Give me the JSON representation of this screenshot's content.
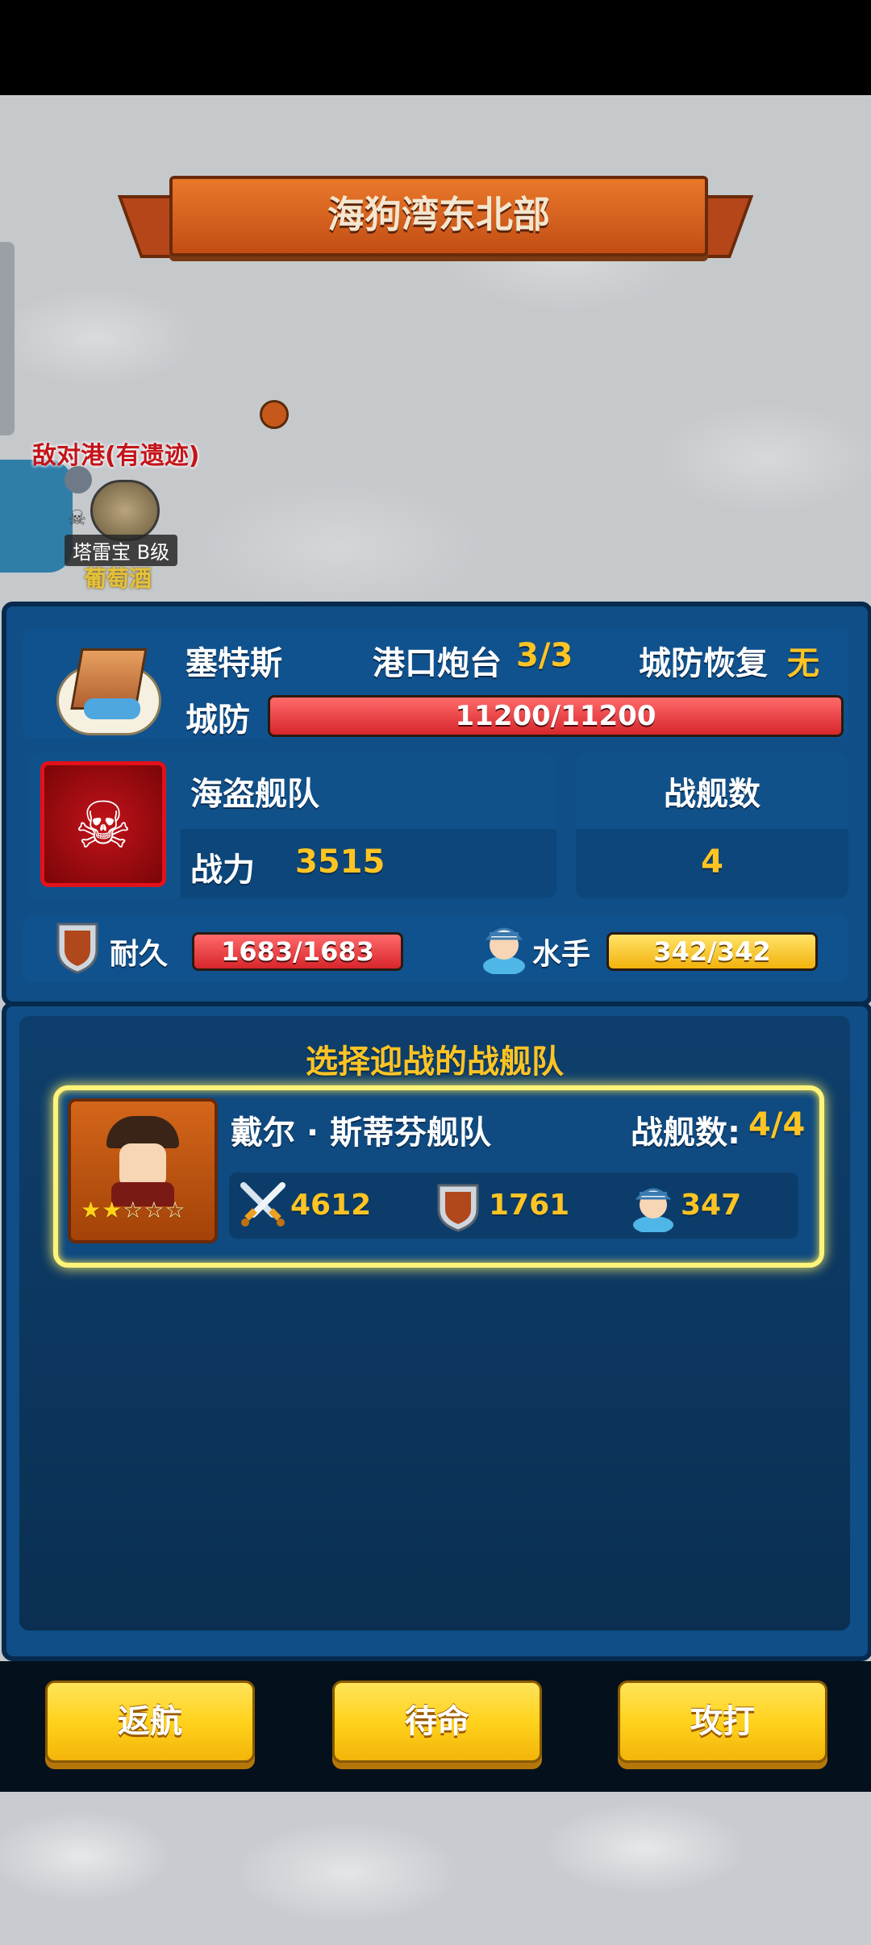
{
  "map": {
    "region_title": "海狗湾东北部",
    "enemy_port_label": "敌对港(有遗迹)",
    "port_badge": "塔雷宝 B级",
    "port_resource": "葡萄酒"
  },
  "city": {
    "name": "塞特斯",
    "port_guns_label": "港口炮台",
    "port_guns_value": "3/3",
    "recovery_label": "城防恢复",
    "recovery_value": "无",
    "defense_label": "城防",
    "defense_value": "11200/11200",
    "defense_fraction": 1.0
  },
  "enemy_fleet": {
    "name": "海盗舰队",
    "power_label": "战力",
    "power_value": "3515",
    "ships_label": "战舰数",
    "ships_value": "4",
    "durability_label": "耐久",
    "durability_value": "1683/1683",
    "durability_fraction": 1.0,
    "sailor_label": "水手",
    "sailor_value": "342/342",
    "sailor_fraction": 1.0
  },
  "select": {
    "title": "选择迎战的战舰队",
    "fleets": [
      {
        "name": "戴尔 · 斯蒂芬舰队",
        "ships_label": "战舰数:",
        "ships_value": "4/4",
        "stars": 2,
        "max_stars": 5,
        "attack": "4612",
        "defense": "1761",
        "sailors": "347"
      }
    ]
  },
  "buttons": {
    "return": "返航",
    "standby": "待命",
    "attack": "攻打"
  },
  "colors": {
    "accent_yellow": "#ffc423",
    "panel_blue": "#0f4e86",
    "hp_red": "#d7262c",
    "highlight": "#fff47a"
  }
}
